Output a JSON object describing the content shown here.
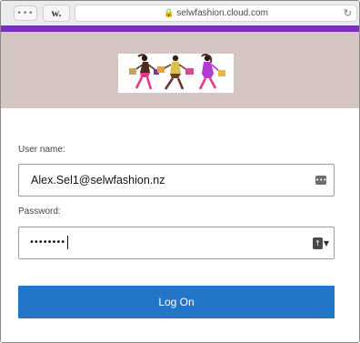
{
  "browser": {
    "tabs_glyph": "•••",
    "site_glyph": "w.",
    "url": "selwfashion.cloud.com",
    "lock_glyph": "🔒",
    "reload_glyph": "↻"
  },
  "theme": {
    "accent": "#7a2fb6",
    "banner_bg": "#d5c6c4",
    "button_bg": "#2375c9"
  },
  "form": {
    "username_label": "User name:",
    "username_value": "Alex.Sel1@selwfashion.nz",
    "password_label": "Password:",
    "password_mask": "••••••••",
    "logon_label": "Log On",
    "autofill_glyph": "•••",
    "keychain_glyph": "▼"
  }
}
